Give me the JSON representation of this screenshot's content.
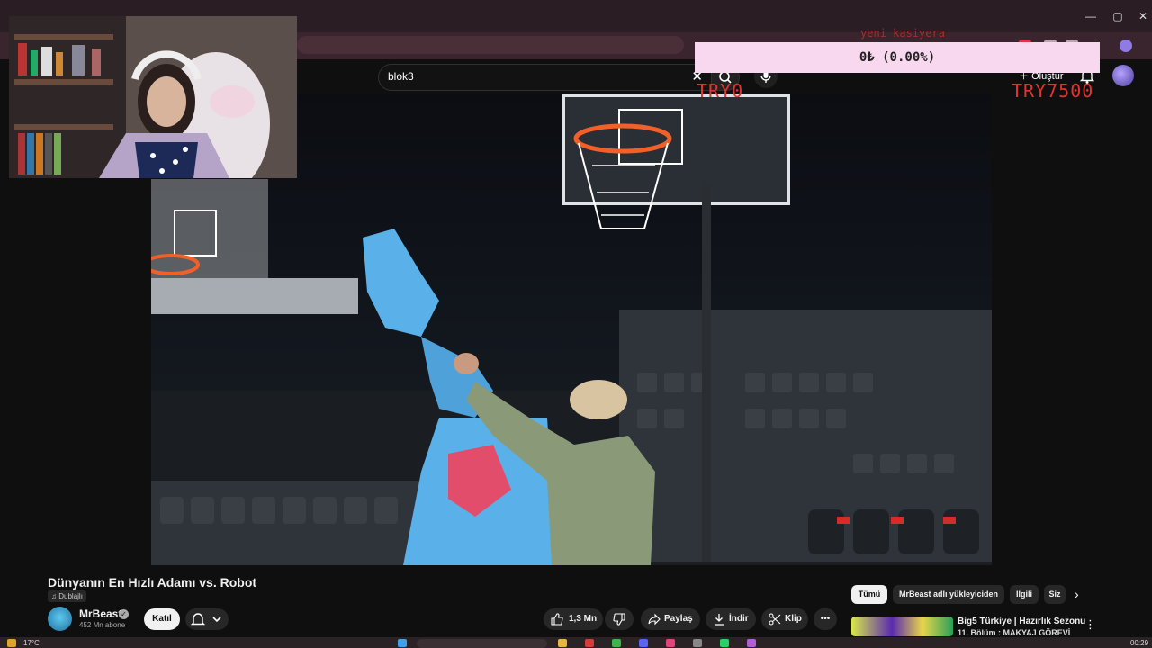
{
  "masthead": {
    "search_query": "blok3",
    "create_label": "Oluştur"
  },
  "overlay": {
    "donation_text": "0₺ (0.00%)",
    "goal_title": "yeni kasiyera",
    "goal_current": "TRY0",
    "goal_target": "TRY7500"
  },
  "video": {
    "title": "Dünyanın En Hızlı Adamı vs. Robot",
    "dub_label": "Dublajlı",
    "channel": "MrBeast",
    "subscribers": "452 Mn abone",
    "join_label": "Katıl",
    "like_count": "1,3 Mn",
    "share_label": "Paylaş",
    "download_label": "İndir",
    "clip_label": "Klip"
  },
  "sidebar": {
    "chips": [
      "Tümü",
      "MrBeast adlı yükleyiciden",
      "İlgili",
      "Siz"
    ],
    "rec_title": "Big5 Türkiye | Hazırlık Sezonu",
    "rec_subtitle": "11. Bölüm : MAKYAJ GÖREVİ"
  },
  "taskbar": {
    "temperature": "17°C",
    "clock": "00:29"
  },
  "colors": {
    "background": "#0f0f0f",
    "donation_bg": "#f8d8ef",
    "goal_text": "#e2332e",
    "robot_blue": "#5ab0e8"
  }
}
